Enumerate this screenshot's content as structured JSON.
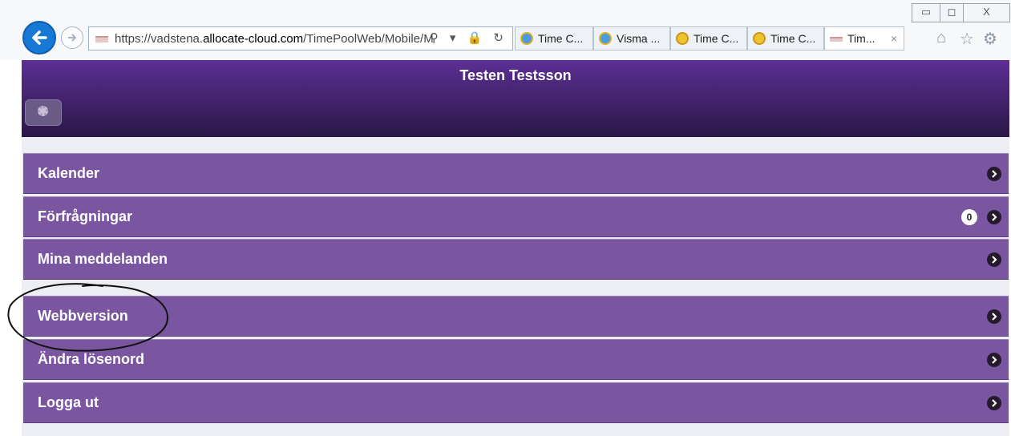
{
  "browser": {
    "url_prefix": "https://vadstena.",
    "url_host": "allocate-cloud.com",
    "url_path": "/TimePoolWeb/Mobile/M",
    "address_tools": "⚲ ▾ 🔒 ↻",
    "tabs": [
      {
        "label": "Time C...",
        "icon": "ie-icon",
        "active": false
      },
      {
        "label": "Visma ...",
        "icon": "ie-icon",
        "active": false
      },
      {
        "label": "Time C...",
        "icon": "clock-icon",
        "active": false
      },
      {
        "label": "Time C...",
        "icon": "clock-icon",
        "active": false
      },
      {
        "label": "Tim...",
        "icon": "page-icon",
        "active": true
      }
    ],
    "tab_close": "×",
    "window_controls": [
      "▭",
      "◻",
      "X"
    ],
    "right_icons": [
      "⌂",
      "☆",
      "⚙"
    ]
  },
  "app": {
    "title": "Testen Testsson",
    "settings_icon": "gear-icon"
  },
  "menu": {
    "kalender": "Kalender",
    "forfragningar": "Förfrågningar",
    "forfragningar_count": "0",
    "mina_meddelanden": "Mina meddelanden",
    "webbversion": "Webbversion",
    "andra_losenord": "Ändra lösenord",
    "logga_ut": "Logga ut"
  },
  "colors": {
    "header_top": "#5c2f95",
    "header_bottom": "#2a1746",
    "menu_item": "#7a55a0",
    "back_button": "#1878d6"
  }
}
